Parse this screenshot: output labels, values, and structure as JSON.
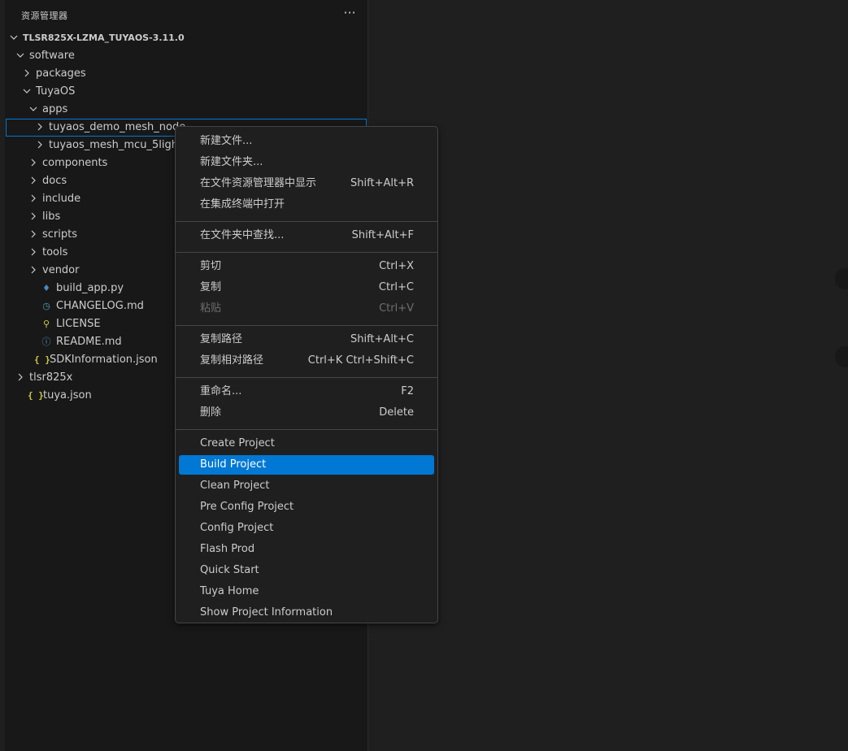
{
  "explorer": {
    "title": "资源管理器",
    "more_actions": "···",
    "tree": [
      {
        "label": "TLSR825X-LZMA_TUYAOS-3.11.0",
        "kind": "root",
        "expanded": true
      },
      {
        "label": "software",
        "kind": "folder",
        "expanded": true
      },
      {
        "label": "packages",
        "kind": "folder",
        "expanded": false
      },
      {
        "label": "TuyaOS",
        "kind": "folder",
        "expanded": true
      },
      {
        "label": "apps",
        "kind": "folder",
        "expanded": true
      },
      {
        "label": "tuyaos_demo_mesh_node",
        "kind": "folder",
        "expanded": false,
        "focused": true
      },
      {
        "label": "tuyaos_mesh_mcu_5light_c",
        "kind": "folder",
        "expanded": false
      },
      {
        "label": "components",
        "kind": "folder",
        "expanded": false
      },
      {
        "label": "docs",
        "kind": "folder",
        "expanded": false
      },
      {
        "label": "include",
        "kind": "folder",
        "expanded": false
      },
      {
        "label": "libs",
        "kind": "folder",
        "expanded": false
      },
      {
        "label": "scripts",
        "kind": "folder",
        "expanded": false
      },
      {
        "label": "tools",
        "kind": "folder",
        "expanded": false
      },
      {
        "label": "vendor",
        "kind": "folder",
        "expanded": false
      },
      {
        "label": "build_app.py",
        "kind": "file",
        "icon": "python-icon"
      },
      {
        "label": "CHANGELOG.md",
        "kind": "file",
        "icon": "clock-icon"
      },
      {
        "label": "LICENSE",
        "kind": "file",
        "icon": "license-icon"
      },
      {
        "label": "README.md",
        "kind": "file",
        "icon": "info-icon"
      },
      {
        "label": "SDKInformation.json",
        "kind": "file",
        "icon": "json-icon"
      },
      {
        "label": "tlsr825x",
        "kind": "folder",
        "expanded": false
      },
      {
        "label": "tuya.json",
        "kind": "file",
        "icon": "json-icon"
      }
    ]
  },
  "context_menu": {
    "groups": [
      [
        {
          "label": "新建文件...",
          "shortcut": ""
        },
        {
          "label": "新建文件夹...",
          "shortcut": ""
        },
        {
          "label": "在文件资源管理器中显示",
          "shortcut": "Shift+Alt+R"
        },
        {
          "label": "在集成终端中打开",
          "shortcut": ""
        }
      ],
      [
        {
          "label": "在文件夹中查找...",
          "shortcut": "Shift+Alt+F"
        }
      ],
      [
        {
          "label": "剪切",
          "shortcut": "Ctrl+X"
        },
        {
          "label": "复制",
          "shortcut": "Ctrl+C"
        },
        {
          "label": "粘贴",
          "shortcut": "Ctrl+V",
          "disabled": true
        }
      ],
      [
        {
          "label": "复制路径",
          "shortcut": "Shift+Alt+C"
        },
        {
          "label": "复制相对路径",
          "shortcut": "Ctrl+K Ctrl+Shift+C"
        }
      ],
      [
        {
          "label": "重命名...",
          "shortcut": "F2"
        },
        {
          "label": "删除",
          "shortcut": "Delete"
        }
      ],
      [
        {
          "label": "Create Project",
          "shortcut": ""
        },
        {
          "label": "Build Project",
          "shortcut": "",
          "active": true
        },
        {
          "label": "Clean Project",
          "shortcut": ""
        },
        {
          "label": "Pre Config Project",
          "shortcut": ""
        },
        {
          "label": "Config Project",
          "shortcut": ""
        },
        {
          "label": "Flash Prod",
          "shortcut": ""
        },
        {
          "label": "Quick Start",
          "shortcut": ""
        },
        {
          "label": "Tuya Home",
          "shortcut": ""
        },
        {
          "label": "Show Project Information",
          "shortcut": ""
        }
      ]
    ]
  },
  "colors": {
    "accent": "#0078d4",
    "sidebar_bg": "#181818",
    "editor_bg": "#1f1f1f",
    "menu_border": "#454545"
  }
}
